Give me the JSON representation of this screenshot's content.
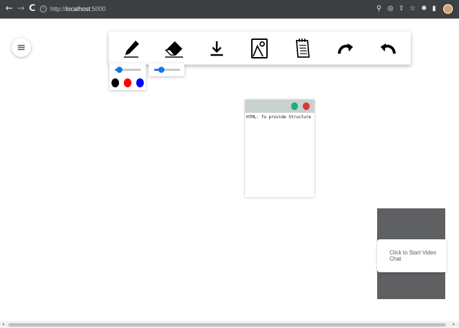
{
  "browser": {
    "url_prefix": "http://",
    "url_host": "localhost",
    "url_port": ":5000",
    "nav": {
      "back_icon": "←",
      "forward_icon": "→",
      "reload_icon": "C"
    }
  },
  "app": {
    "menu_icon": "≡",
    "toolbar": {
      "tools": [
        {
          "name": "pencil-icon"
        },
        {
          "name": "eraser-icon"
        },
        {
          "name": "download-icon"
        },
        {
          "name": "image-icon"
        },
        {
          "name": "notepad-icon"
        },
        {
          "name": "redo-icon"
        },
        {
          "name": "undo-icon"
        }
      ]
    },
    "pen_size_fraction": 0.15,
    "eraser_size_fraction": 0.25,
    "colors": [
      "#000000",
      "#ff0000",
      "#0000ff"
    ],
    "sticky_note": {
      "text": "HTML: To provide Structure",
      "dot_colors": [
        "#1aaf7c",
        "#d93a35"
      ]
    },
    "video_chat": {
      "label": "Click to Start Video Chat"
    }
  }
}
